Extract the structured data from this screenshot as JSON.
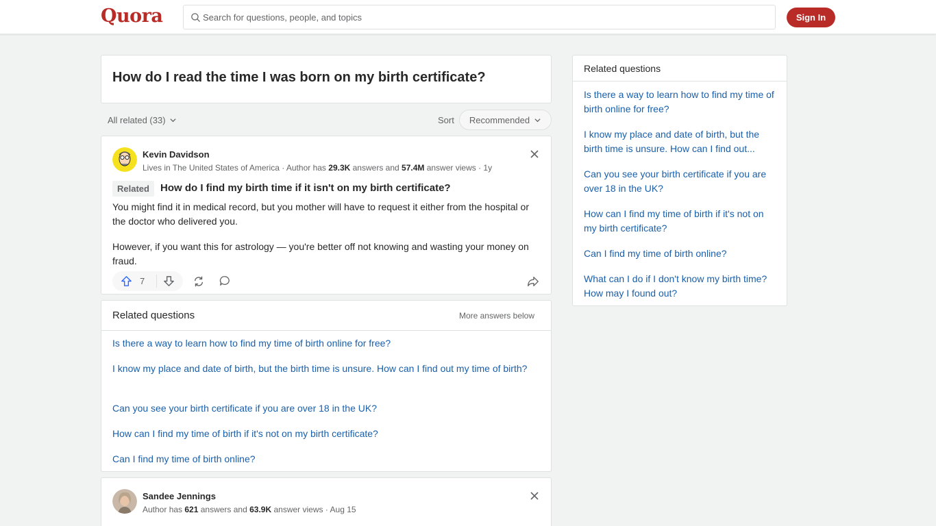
{
  "header": {
    "logo": "Quora",
    "search_placeholder": "Search for questions, people, and topics",
    "signin_label": "Sign In"
  },
  "question": {
    "title": "How do I read the time I was born on my birth certificate?"
  },
  "filters": {
    "all_related": "All related (33)",
    "sort_label": "Sort",
    "sort_value": "Recommended"
  },
  "answer1": {
    "author": "Kevin Davidson",
    "meta_prefix": "Lives in The United States of America · Author has ",
    "answers_count": "29.3K",
    "meta_mid": " answers and ",
    "views_count": "57.4M",
    "meta_suffix": " answer views · 1y",
    "badge": "Related",
    "related_question": "How do I find my birth time if it isn't on my birth certificate?",
    "paragraph1": "You might find it in medical record, but you mother will have to request it either from the hospital or the doctor who delivered you.",
    "paragraph2": "However, if you want this for astrology — you're better off not knowing and wasting your money on fraud.",
    "upvotes": "7"
  },
  "related_inline": {
    "title": "Related questions",
    "more": "More answers below",
    "items": [
      "Is there a way to learn how to find my time of birth online for free?",
      "I know my place and date of birth, but the birth time is unsure. How can I find out my time of birth?",
      "Can you see your birth certificate if you are over 18 in the UK?",
      "How can I find my time of birth if it's not on my birth certificate?",
      "Can I find my time of birth online?"
    ]
  },
  "answer2": {
    "author": "Sandee Jennings",
    "meta_prefix": "Author has ",
    "answers_count": "621",
    "meta_mid": " answers and ",
    "views_count": "63.9K",
    "meta_suffix": " answer views · Aug 15"
  },
  "sidebar": {
    "title": "Related questions",
    "items": [
      "Is there a way to learn how to find my time of birth online for free?",
      "I know my place and date of birth, but the birth time is unsure. How can I find out...",
      "Can you see your birth certificate if you are over 18 in the UK?",
      "How can I find my time of birth if it's not on my birth certificate?",
      "Can I find my time of birth online?",
      "What can I do if I don't know my birth time? How may I found out?"
    ]
  },
  "colors": {
    "brand": "#b92b27",
    "link": "#195faa",
    "upvote": "#2e69ff"
  }
}
